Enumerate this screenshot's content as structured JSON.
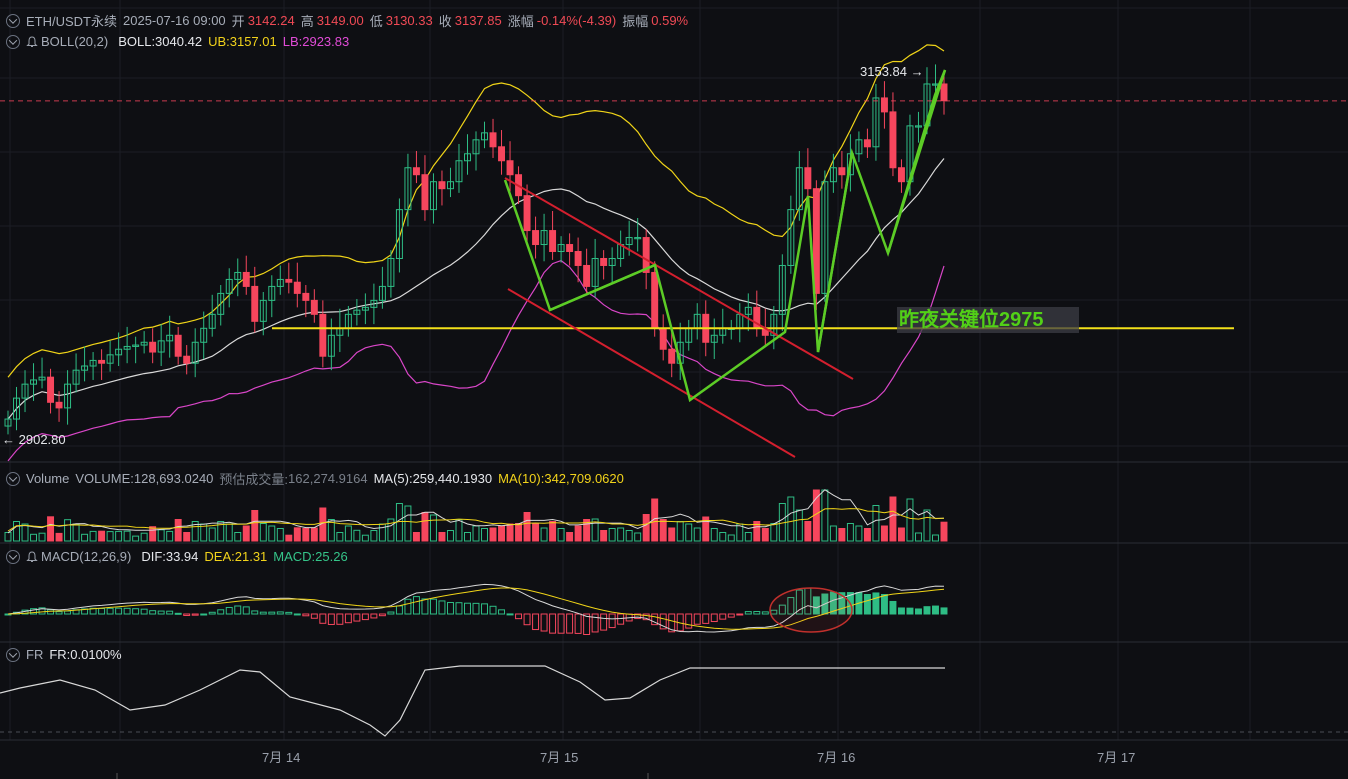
{
  "header": {
    "symbol": "ETH/USDT永续",
    "datetime": "2025-07-16 09:00",
    "open_label": "开",
    "open": "3142.24",
    "high_label": "高",
    "high": "3149.00",
    "low_label": "低",
    "low": "3130.33",
    "close_label": "收",
    "close": "3137.85",
    "change_label": "涨幅",
    "change": "-0.14%(-4.39)",
    "amplitude_label": "振幅",
    "amplitude": "0.59%"
  },
  "boll": {
    "name": "BOLL(20,2)",
    "mid": "BOLL:3040.42",
    "ub": "UB:3157.01",
    "lb": "LB:2923.83"
  },
  "volume": {
    "name": "Volume",
    "value": "VOLUME:128,693.0240",
    "est_label": "预估成交量:",
    "est": "162,274.9164",
    "ma5": "MA(5):259,440.1930",
    "ma10": "MA(10):342,709.0620"
  },
  "macd": {
    "name": "MACD(12,26,9)",
    "dif": "DIF:33.94",
    "dea": "DEA:21.31",
    "macd": "MACD:25.26"
  },
  "fr": {
    "name": "FR",
    "value": "FR:0.0100%"
  },
  "price_high_tag": "3153.84",
  "price_low_tag": "2902.80",
  "annotation": "昨夜关键位2975",
  "x_labels": [
    "7月 14",
    "7月 15",
    "7月 16",
    "7月 17"
  ],
  "colors": {
    "up": "#2ebd85",
    "down": "#f6465d",
    "boll_mid": "#d9d9d9",
    "boll_ub": "#f0d418",
    "boll_lb": "#d946c8",
    "key_level": "#f2e01a",
    "channel": "#d31f2e",
    "zigzag": "#5ccc26"
  },
  "chart_data": {
    "type": "candlestick",
    "interval_hours": 1,
    "x_range_labels": [
      "7月 14",
      "7月 15",
      "7月 16",
      "7月 17"
    ],
    "visible_high": 3153.84,
    "visible_low": 2902.8,
    "key_level": 2975,
    "last_close": 3137.85,
    "price_closes": [
      2910,
      2925,
      2935,
      2938,
      2940,
      2922,
      2918,
      2935,
      2945,
      2948,
      2952,
      2950,
      2956,
      2960,
      2962,
      2963,
      2965,
      2958,
      2966,
      2970,
      2955,
      2950,
      2965,
      2975,
      2985,
      3000,
      3010,
      3015,
      3005,
      2980,
      2995,
      3005,
      3010,
      3008,
      3000,
      2995,
      2985,
      2955,
      2970,
      2975,
      2985,
      2988,
      2990,
      2995,
      3005,
      3025,
      3060,
      3090,
      3085,
      3060,
      3080,
      3075,
      3080,
      3095,
      3100,
      3110,
      3115,
      3105,
      3095,
      3085,
      3070,
      3045,
      3035,
      3045,
      3030,
      3035,
      3030,
      3020,
      3005,
      3025,
      3020,
      3025,
      3035,
      3040,
      3040,
      3015,
      2975,
      2960,
      2950,
      2965,
      2975,
      2985,
      2965,
      2970,
      2975,
      2975,
      2985,
      2990,
      2975,
      2970,
      2985,
      3020,
      3060,
      3090,
      3075,
      3000,
      3080,
      3090,
      3085,
      3100,
      3110,
      3105,
      3140,
      3130,
      3090,
      3080,
      3120,
      3120,
      3150,
      3150,
      3138
    ]
  }
}
